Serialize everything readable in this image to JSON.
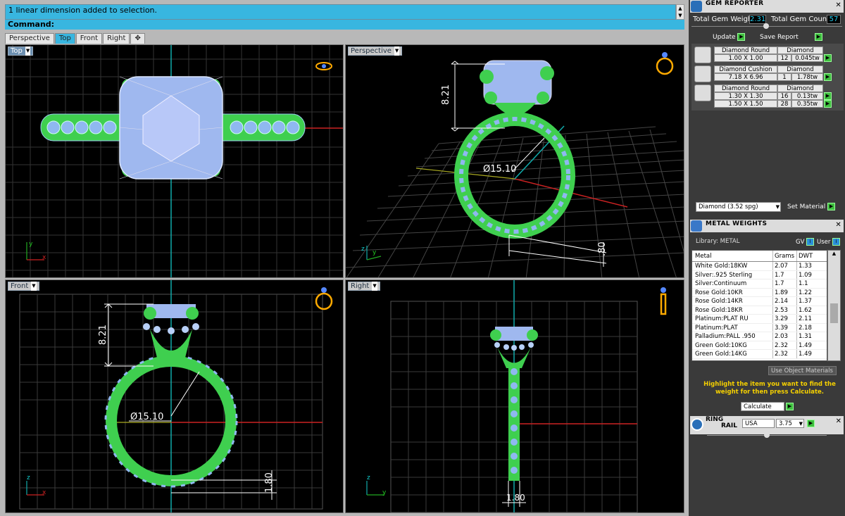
{
  "command_history": {
    "text": "1 linear dimension added to selection.",
    "scroll_up": "▲",
    "scroll_down": "▼"
  },
  "command_prompt": "Command:",
  "viewport_tabs": [
    "Perspective",
    "Top",
    "Front",
    "Right",
    "✥"
  ],
  "viewports": {
    "top": {
      "label": "Top",
      "axis_y": "y",
      "axis_x": "x"
    },
    "perspective": {
      "label": "Perspective",
      "dim_height": "8.21",
      "dim_diameter": "Ø15.10",
      "dim_band": ".80",
      "axis_z": "z",
      "axis_y": "y"
    },
    "front": {
      "label": "Front",
      "dim_height": "8.21",
      "dim_diameter": "Ø15.10",
      "dim_band": "1.80",
      "axis_z": "z",
      "axis_x": "x"
    },
    "right": {
      "label": "Right",
      "dim_band": "1.80",
      "axis_z": "z",
      "axis_y": "y"
    }
  },
  "gem_reporter": {
    "title": "GEM REPORTER",
    "total_weight_label": "Total Gem Weight",
    "total_weight_value": "2.31",
    "total_count_label": "Total Gem Count",
    "total_count_value": "57",
    "update_label": "Update",
    "save_report_label": "Save Report",
    "groups": [
      {
        "shape": "Diamond Round",
        "material": "Diamond",
        "rows": [
          {
            "size": "1.00 X 1.00",
            "count": "12",
            "weight": "0.045tw"
          }
        ]
      },
      {
        "shape": "Diamond Cushion",
        "material": "Diamond",
        "rows": [
          {
            "size": "7.18 X 6.96",
            "count": "1",
            "weight": "1.78tw"
          }
        ]
      },
      {
        "shape": "Diamond Round",
        "material": "Diamond",
        "rows": [
          {
            "size": "1.30 X 1.30",
            "count": "16",
            "weight": "0.13tw"
          },
          {
            "size": "1.50 X 1.50",
            "count": "28",
            "weight": "0.35tw"
          }
        ]
      }
    ],
    "material_select": "Diamond     (3.52 spg)",
    "set_material_label": "Set Material"
  },
  "metal_weights": {
    "title": "METAL WEIGHTS",
    "library_label": "Library: METAL",
    "gv_label": "GV",
    "user_label": "User",
    "columns": [
      "Metal",
      "Grams",
      "DWT"
    ],
    "rows": [
      [
        "White Gold:18KW",
        "2.07",
        "1.33"
      ],
      [
        "Silver:.925 Sterling",
        "1.7",
        "1.09"
      ],
      [
        "Silver:Continuum",
        "1.7",
        "1.1"
      ],
      [
        "Rose Gold:10KR",
        "1.89",
        "1.22"
      ],
      [
        "Rose Gold:14KR",
        "2.14",
        "1.37"
      ],
      [
        "Rose Gold:18KR",
        "2.53",
        "1.62"
      ],
      [
        "Platinum:PLAT RU",
        "3.29",
        "2.11"
      ],
      [
        "Platinum:PLAT",
        "3.39",
        "2.18"
      ],
      [
        "Palladium:PALL .950",
        "2.03",
        "1.31"
      ],
      [
        "Green Gold:10KG",
        "2.32",
        "1.49"
      ],
      [
        "Green Gold:14KG",
        "2.32",
        "1.49"
      ]
    ],
    "use_object_materials": "Use Object Materials",
    "hint": "Highlight the item you want to find the weight for then press Calculate.",
    "calculate_label": "Calculate"
  },
  "ring_rail": {
    "title_line1": "RING",
    "title_line2": "RAIL",
    "region": "USA",
    "size": "3.75"
  }
}
